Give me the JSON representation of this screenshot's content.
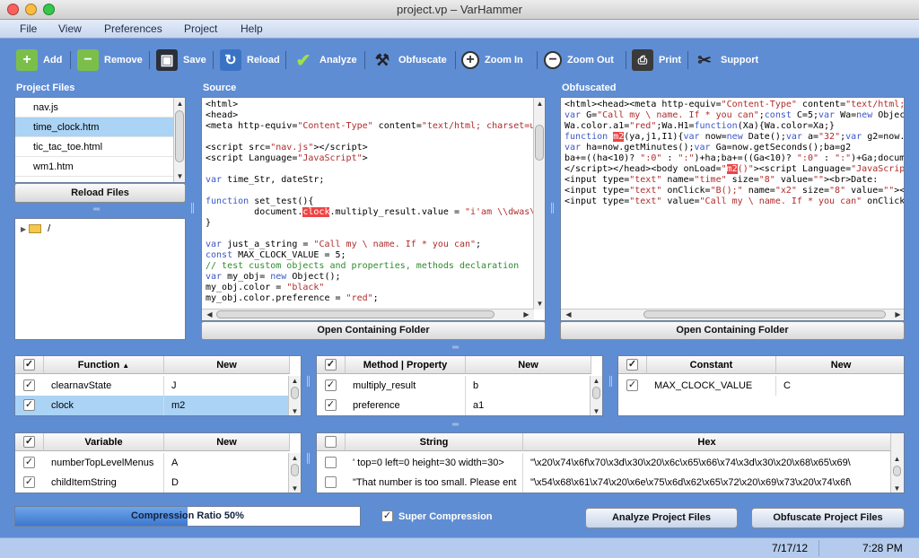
{
  "window": {
    "title": "project.vp – VarHammer"
  },
  "menu": [
    "File",
    "View",
    "Preferences",
    "Project",
    "Help"
  ],
  "toolbar": {
    "add": "Add",
    "remove": "Remove",
    "save": "Save",
    "reload": "Reload",
    "analyze": "Analyze",
    "obfuscate": "Obfuscate",
    "zoom_in": "Zoom In",
    "zoom_out": "Zoom Out",
    "print": "Print",
    "support": "Support"
  },
  "icons": {
    "add": "add-file-icon",
    "remove": "remove-file-icon",
    "save": "floppy-icon",
    "reload": "refresh-icon",
    "analyze": "checkmark-icon",
    "obfuscate": "hammer-icon",
    "zoom_in": "zoom-in-icon",
    "zoom_out": "zoom-out-icon",
    "print": "printer-icon",
    "support": "tools-icon"
  },
  "sections": {
    "project_files": "Project Files",
    "source": "Source",
    "obfuscated": "Obfuscated"
  },
  "files": [
    "nav.js",
    "time_clock.htm",
    "tic_tac_toe.html",
    "wm1.htm"
  ],
  "selected_file": "time_clock.htm",
  "reload_files": "Reload Files",
  "folder_root": "/",
  "open_folder": "Open Containing Folder",
  "functions": {
    "headers": [
      "Function",
      "New"
    ],
    "rows": [
      [
        "clearnavState",
        "J"
      ],
      [
        "clock",
        "m2"
      ]
    ]
  },
  "methods": {
    "headers": [
      "Method | Property",
      "New"
    ],
    "rows": [
      [
        "multiply_result",
        "b"
      ],
      [
        "preference",
        "a1"
      ]
    ]
  },
  "constants": {
    "headers": [
      "Constant",
      "New"
    ],
    "rows": [
      [
        "MAX_CLOCK_VALUE",
        "C"
      ]
    ]
  },
  "variables": {
    "headers": [
      "Variable",
      "New"
    ],
    "rows": [
      [
        "numberTopLevelMenus",
        "A"
      ],
      [
        "childItemString",
        "D"
      ]
    ]
  },
  "strings": {
    "headers": [
      "String",
      "Hex"
    ],
    "rows": [
      [
        "' top=0 left=0 height=30 width=30>",
        "\"\\x20\\x74\\x6f\\x70\\x3d\\x30\\x20\\x6c\\x65\\x66\\x74\\x3d\\x30\\x20\\x68\\x65\\x69\\"
      ],
      [
        "\"That number is too small. Please ent",
        "\"\\x54\\x68\\x61\\x74\\x20\\x6e\\x75\\x6d\\x62\\x65\\x72\\x20\\x69\\x73\\x20\\x74\\x6f\\"
      ]
    ]
  },
  "compression": {
    "label": "Compression Ratio 50%",
    "ratio": 0.5
  },
  "super_compression": {
    "label": "Super Compression",
    "checked": true
  },
  "buttons": {
    "analyze_project": "Analyze Project Files",
    "obfuscate_project": "Obfuscate Project Files"
  },
  "status": {
    "date": "7/17/12",
    "time": "7:28 PM"
  },
  "colors": {
    "window_bg": "#5f8dd3",
    "selection": "#abd3f5",
    "highlight": "#e44444"
  }
}
